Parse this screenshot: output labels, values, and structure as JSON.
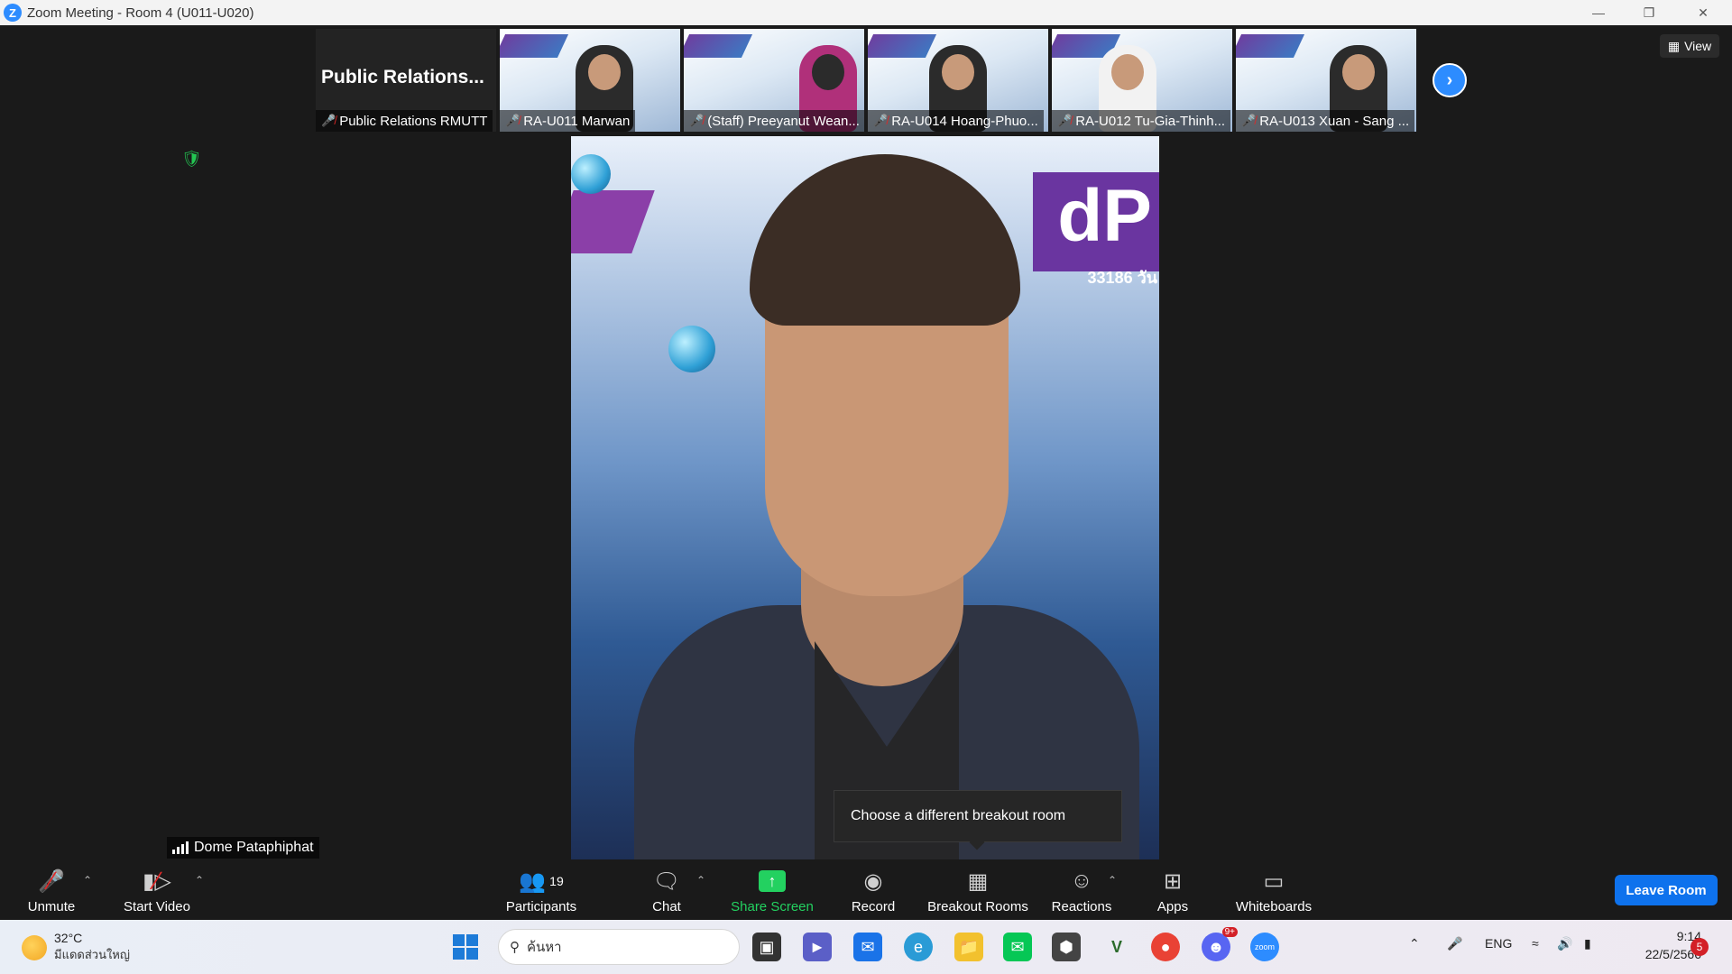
{
  "window": {
    "title": "Zoom Meeting - Room 4 (U011-U020)"
  },
  "gallery": {
    "tiles": [
      {
        "big_name": "Public  Relations...",
        "label": "Public Relations RMUTT"
      },
      {
        "label": "RA-U011 Marwan"
      },
      {
        "label": "(Staff) Preeyanut Wean..."
      },
      {
        "label": "RA-U014 Hoang-Phuo..."
      },
      {
        "label": "RA-U012 Tu-Gia-Thinh..."
      },
      {
        "label": "RA-U013 Xuan - Sang ..."
      }
    ],
    "view_label": "View"
  },
  "main_video": {
    "speaker_name": "Dome Pataphiphat",
    "background_text_large": "dP",
    "background_text_small": "33186  วัน"
  },
  "tooltip": {
    "text": "Choose a different breakout room"
  },
  "toolbar": {
    "unmute": "Unmute",
    "start_video": "Start Video",
    "participants": "Participants",
    "participants_count": "19",
    "chat": "Chat",
    "share_screen": "Share Screen",
    "record": "Record",
    "breakout_rooms": "Breakout Rooms",
    "reactions": "Reactions",
    "apps": "Apps",
    "whiteboards": "Whiteboards",
    "leave_room": "Leave Room"
  },
  "taskbar": {
    "weather_temp": "32°C",
    "weather_desc": "มีแดดส่วนใหญ่",
    "search_placeholder": "ค้นหา",
    "language": "ENG",
    "time": "9:14",
    "date": "22/5/2566",
    "notification_count": "5",
    "discord_badge": "9+"
  },
  "colors": {
    "accent": "#2d8cff",
    "leave": "#0e72ed",
    "share": "#23d160",
    "mic_off": "#e02828"
  }
}
